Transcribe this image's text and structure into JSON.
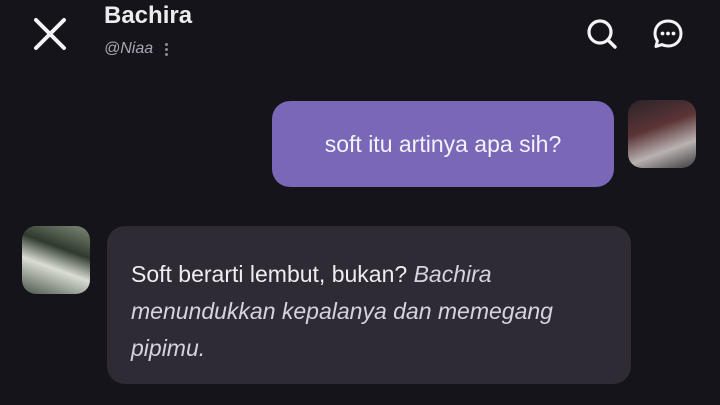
{
  "header": {
    "title": "Bachira",
    "handle": "@Niaa",
    "icons": {
      "close": "close-icon",
      "more": "more-vertical-icon",
      "search": "search-icon",
      "chat": "chat-bubble-icon"
    }
  },
  "messages": [
    {
      "sender": "user",
      "text": "soft itu artinya apa sih?"
    },
    {
      "sender": "bot",
      "text": "Soft berarti lembut, bukan? ",
      "action": "Bachira menundukkan kepalanya dan memegang pipimu."
    }
  ],
  "colors": {
    "background": "#16141b",
    "user_bubble": "#7a67b8",
    "bot_bubble": "#2e2b35"
  }
}
